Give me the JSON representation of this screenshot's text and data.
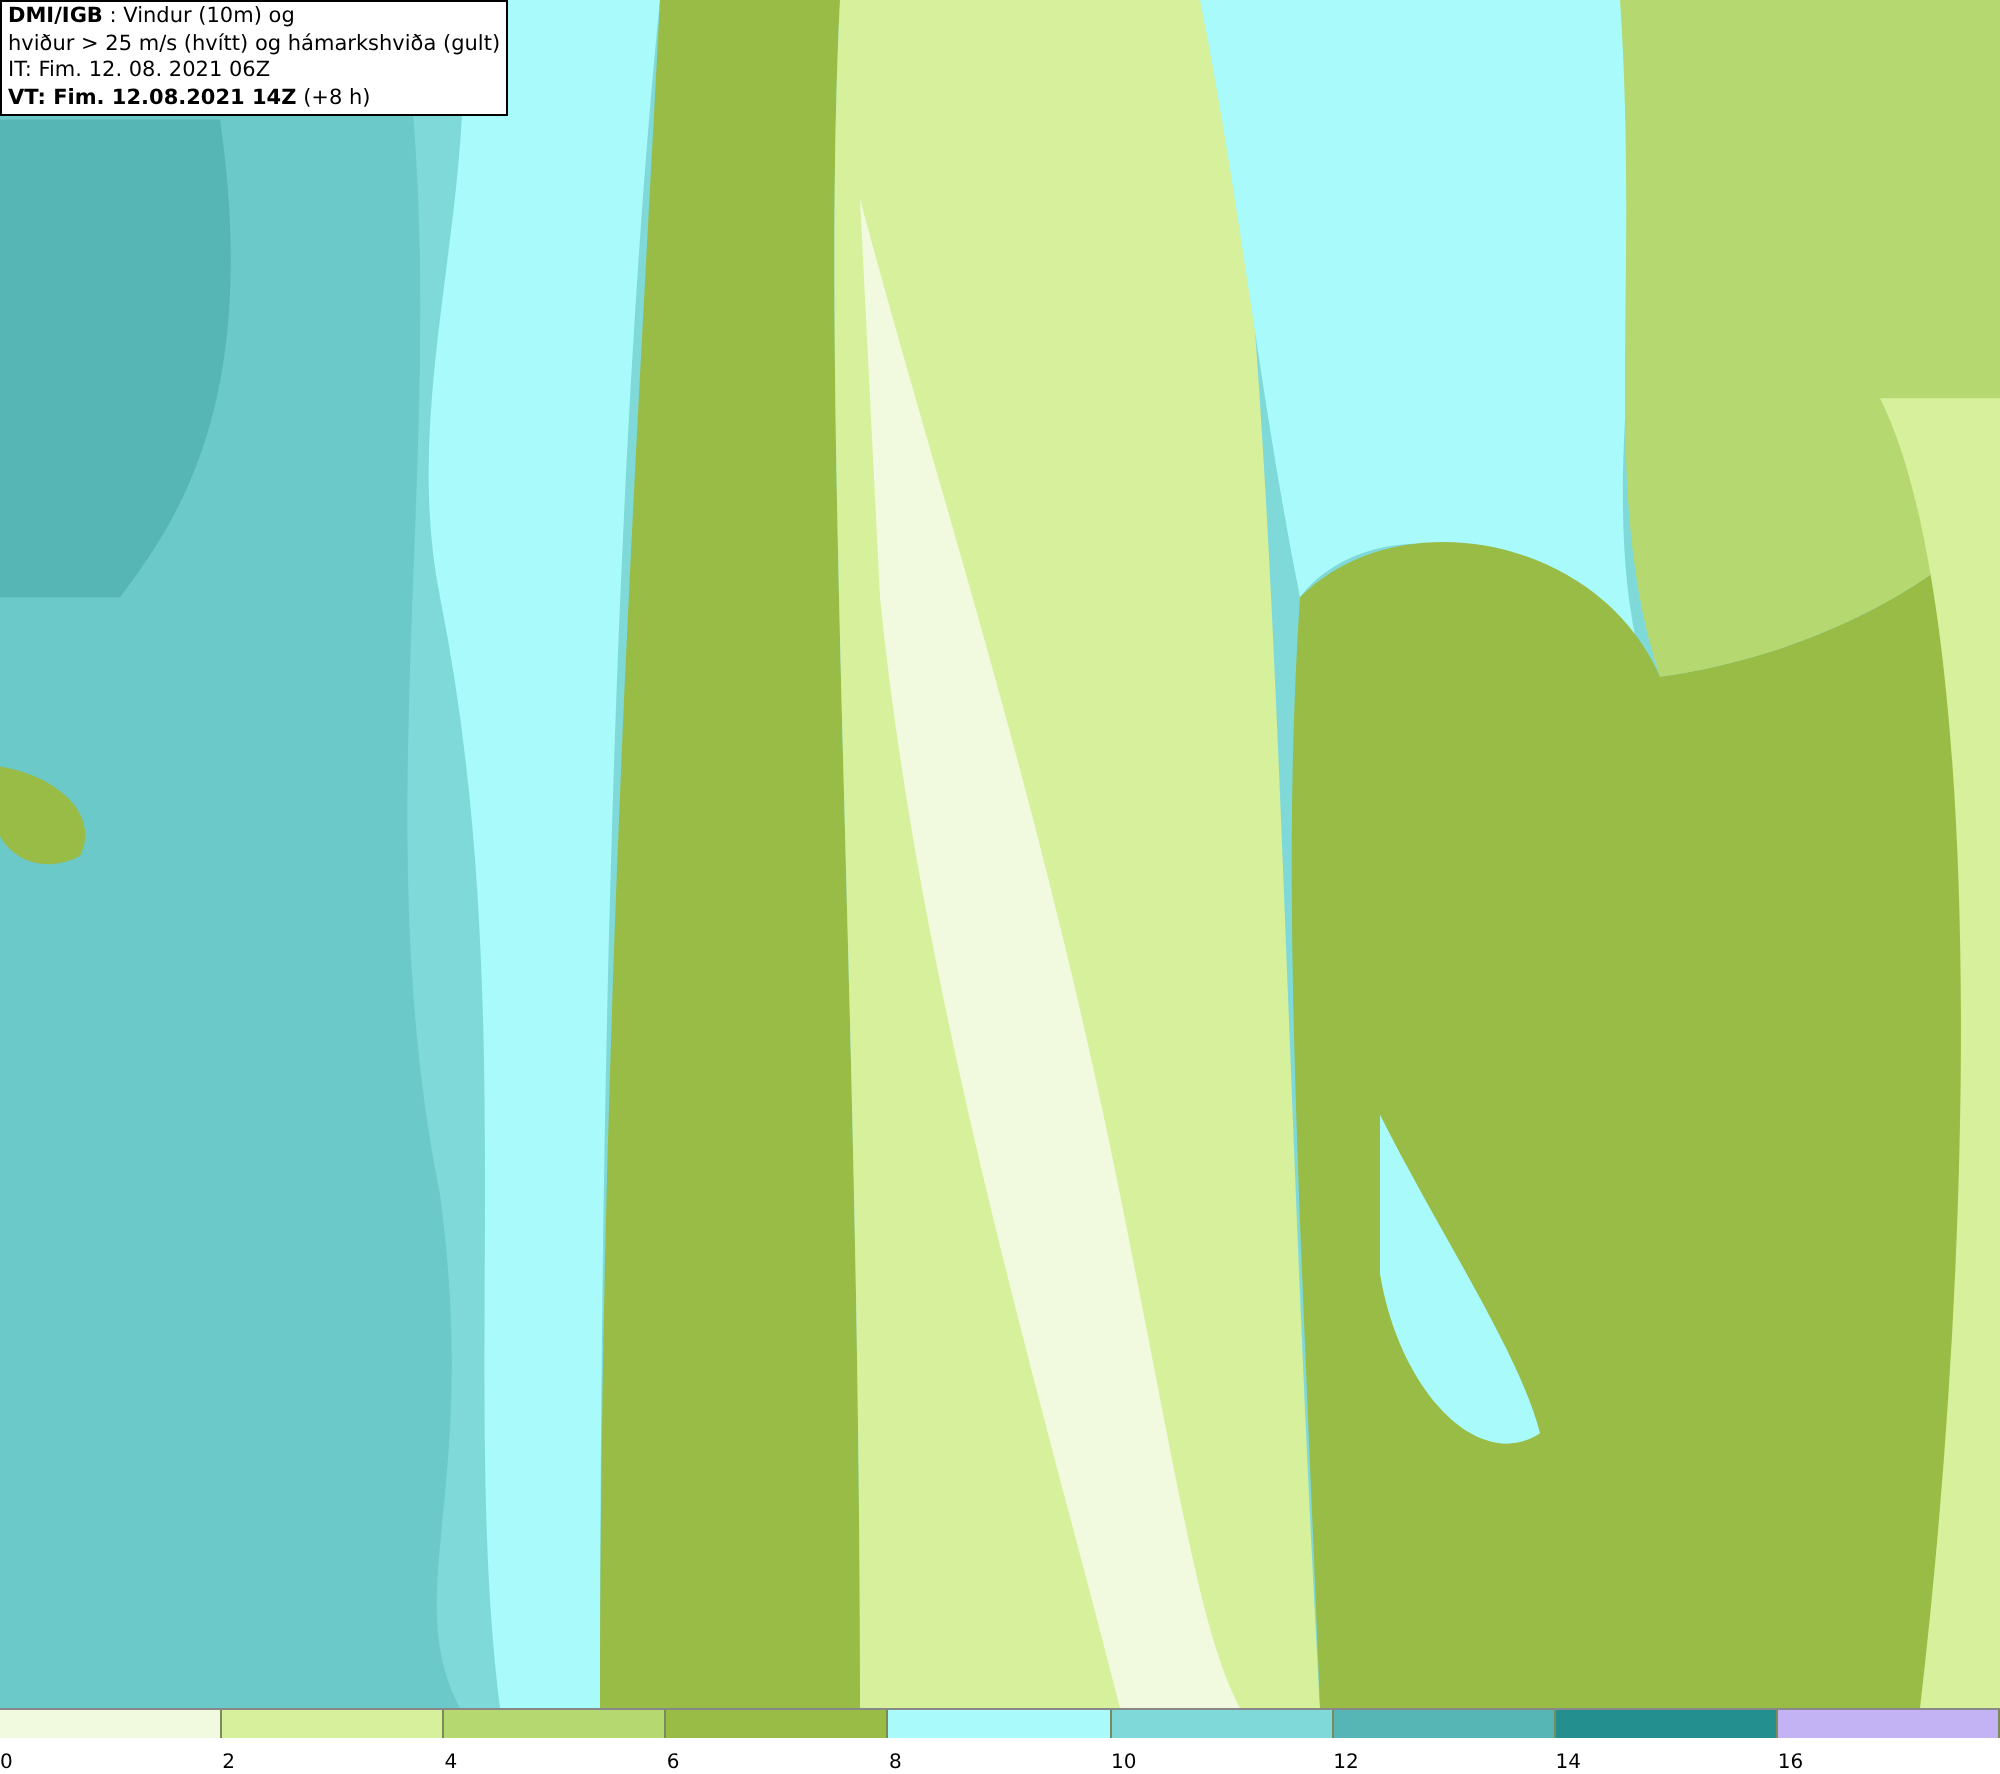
{
  "map": {
    "title_lines": [
      "**DMI/IGB** : Vindur (10m) og",
      "hviður > 25 m/s (hvítt) og hámarkshviða (gult)",
      "IT: Fim. 12. 08. 2021 06Z",
      "**VT: Fim. 12.08.2021 14Z** (+8 h)"
    ]
  },
  "legend": [
    {
      "label": "0",
      "color": "#f1fadf"
    },
    {
      "label": "2",
      "color": "#d6f09c"
    },
    {
      "label": "4",
      "color": "#b5d870"
    },
    {
      "label": "6",
      "color": "#98bc45"
    },
    {
      "label": "8",
      "color": "#a9fafa"
    },
    {
      "label": "10",
      "color": "#7fd9d9"
    },
    {
      "label": "12",
      "color": "#56b5b5"
    },
    {
      "label": "14",
      "color": "#248f8f"
    },
    {
      "label": "16",
      "color": "#c3b3f5"
    }
  ]
}
